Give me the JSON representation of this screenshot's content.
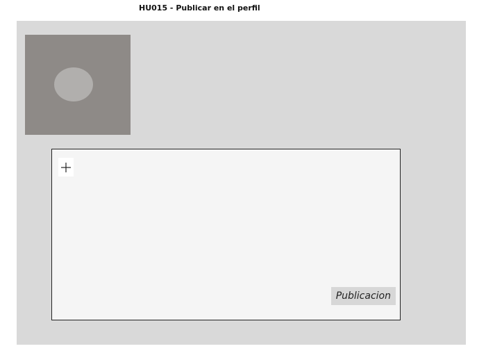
{
  "header": {
    "title": "HU015 - Publicar en el perfil"
  },
  "profile": {
    "avatar_icon": "avatar-placeholder-icon"
  },
  "composer": {
    "add_icon": "plus-icon",
    "publish_label": "Publicacion"
  }
}
